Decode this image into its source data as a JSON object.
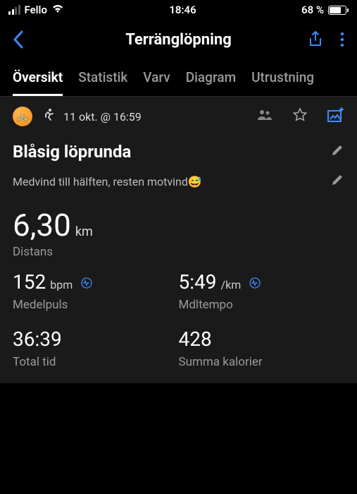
{
  "status": {
    "carrier": "Fello",
    "time": "18:46",
    "battery_pct": "68 %"
  },
  "nav": {
    "title": "Terränglöpning"
  },
  "tabs": {
    "overview": "Översikt",
    "stats": "Statistik",
    "laps": "Varv",
    "chart": "Diagram",
    "gear": "Utrustning"
  },
  "activity": {
    "datetime": "11 okt. @ 16:59",
    "title": "Blåsig löprunda",
    "description": "Medvind till hälften, resten motvind😅"
  },
  "stats": {
    "distance": {
      "value": "6,30",
      "unit": "km",
      "label": "Distans"
    },
    "avg_hr": {
      "value": "152",
      "unit": "bpm",
      "label": "Medelpuls"
    },
    "avg_pace": {
      "value": "5:49",
      "unit": "/km",
      "label": "Mdltempo"
    },
    "total_time": {
      "value": "36:39",
      "label": "Total tid"
    },
    "calories": {
      "value": "428",
      "label": "Summa kalorier"
    }
  }
}
